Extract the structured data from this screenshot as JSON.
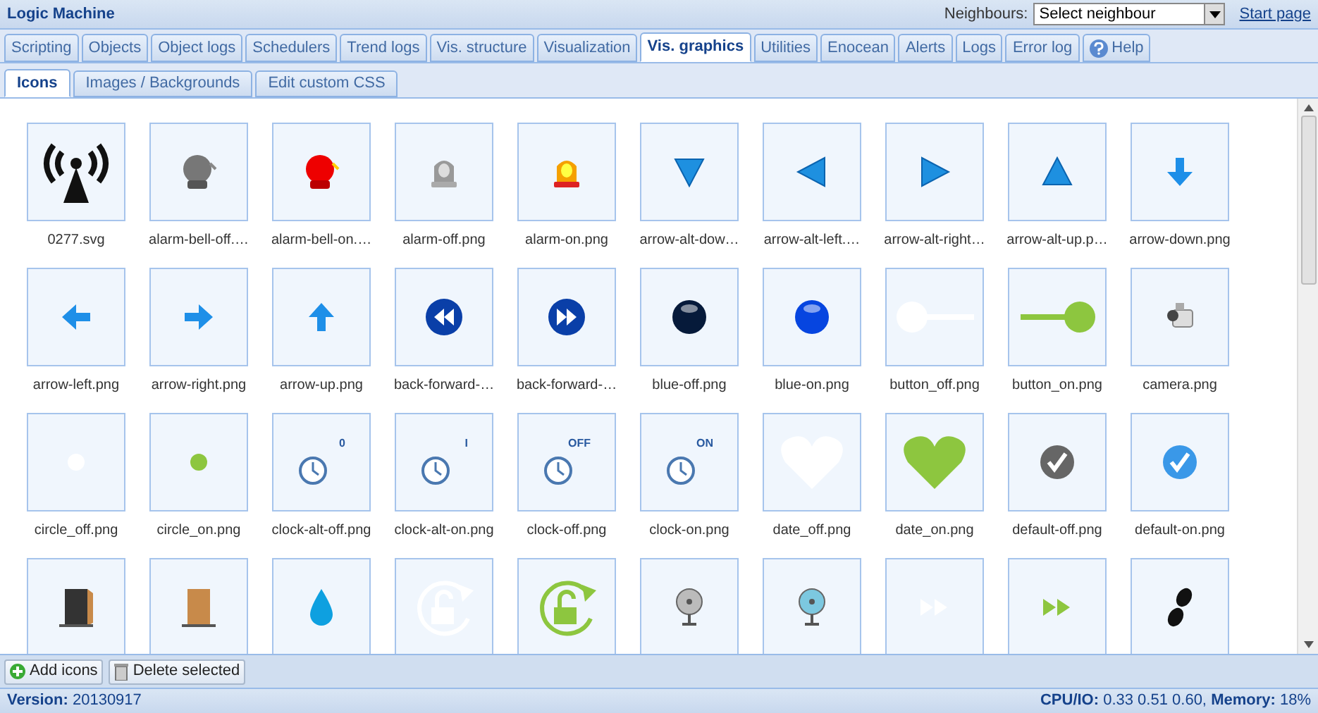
{
  "window": {
    "title": "Logic Machine"
  },
  "neighbours": {
    "label": "Neighbours:",
    "placeholder": "Select neighbour"
  },
  "start_link": "Start page",
  "tabs": [
    {
      "label": "Scripting",
      "selected": false
    },
    {
      "label": "Objects",
      "selected": false
    },
    {
      "label": "Object logs",
      "selected": false
    },
    {
      "label": "Schedulers",
      "selected": false
    },
    {
      "label": "Trend logs",
      "selected": false
    },
    {
      "label": "Vis. structure",
      "selected": false
    },
    {
      "label": "Visualization",
      "selected": false
    },
    {
      "label": "Vis. graphics",
      "selected": true
    },
    {
      "label": "Utilities",
      "selected": false
    },
    {
      "label": "Enocean",
      "selected": false
    },
    {
      "label": "Alerts",
      "selected": false
    },
    {
      "label": "Logs",
      "selected": false
    },
    {
      "label": "Error log",
      "selected": false
    },
    {
      "label": "Help",
      "selected": false,
      "kind": "help"
    }
  ],
  "subtabs": [
    {
      "label": "Icons",
      "selected": true
    },
    {
      "label": "Images / Backgrounds",
      "selected": false
    },
    {
      "label": "Edit custom CSS",
      "selected": false
    }
  ],
  "icons": [
    {
      "label": "0277.svg",
      "kind": "antenna"
    },
    {
      "label": "alarm-bell-off.…",
      "kind": "bell",
      "on": false
    },
    {
      "label": "alarm-bell-on.…",
      "kind": "bell",
      "on": true
    },
    {
      "label": "alarm-off.png",
      "kind": "beacon",
      "on": false
    },
    {
      "label": "alarm-on.png",
      "kind": "beacon",
      "on": true
    },
    {
      "label": "arrow-alt-dow…",
      "kind": "downtriangle"
    },
    {
      "label": "arrow-alt-left.…",
      "kind": "lefttriangle"
    },
    {
      "label": "arrow-alt-right…",
      "kind": "righttriangle"
    },
    {
      "label": "arrow-alt-up.p…",
      "kind": "uptriangle"
    },
    {
      "label": "arrow-down.png",
      "kind": "downarrow"
    },
    {
      "label": "arrow-left.png",
      "kind": "leftarrow"
    },
    {
      "label": "arrow-right.png",
      "kind": "rightarrow"
    },
    {
      "label": "arrow-up.png",
      "kind": "uparrow"
    },
    {
      "label": "back-forward-…",
      "kind": "rewind"
    },
    {
      "label": "back-forward-…",
      "kind": "forward"
    },
    {
      "label": "blue-off.png",
      "kind": "sphere",
      "on": false
    },
    {
      "label": "blue-on.png",
      "kind": "sphere",
      "on": true
    },
    {
      "label": "button_off.png",
      "kind": "toggle",
      "on": false
    },
    {
      "label": "button_on.png",
      "kind": "toggle",
      "on": true
    },
    {
      "label": "camera.png",
      "kind": "camera"
    },
    {
      "label": "circle_off.png",
      "kind": "dot",
      "on": false
    },
    {
      "label": "circle_on.png",
      "kind": "dot",
      "on": true
    },
    {
      "label": "clock-alt-off.png",
      "kind": "clock",
      "badge": "0"
    },
    {
      "label": "clock-alt-on.png",
      "kind": "clock",
      "badge": "I"
    },
    {
      "label": "clock-off.png",
      "kind": "clock",
      "badge": "OFF"
    },
    {
      "label": "clock-on.png",
      "kind": "clock",
      "badge": "ON"
    },
    {
      "label": "date_off.png",
      "kind": "heart",
      "on": false
    },
    {
      "label": "date_on.png",
      "kind": "heart",
      "on": true
    },
    {
      "label": "default-off.png",
      "kind": "check",
      "on": false
    },
    {
      "label": "default-on.png",
      "kind": "check",
      "on": true
    },
    {
      "kind": "door",
      "on": true
    },
    {
      "kind": "door",
      "on": false
    },
    {
      "kind": "drop"
    },
    {
      "kind": "lock",
      "on": false
    },
    {
      "kind": "lock",
      "on": true
    },
    {
      "kind": "fan",
      "on": false
    },
    {
      "kind": "fan",
      "on": true
    },
    {
      "kind": "fastforward",
      "on": false
    },
    {
      "kind": "fastforward",
      "on": true
    },
    {
      "kind": "footprints"
    }
  ],
  "toolbar": [
    {
      "label": "Add icons",
      "kind": "add"
    },
    {
      "label": "Delete selected",
      "kind": "delete"
    }
  ],
  "status": {
    "version_label": "Version:",
    "version": "20130917",
    "cpu_label": "CPU/IO:",
    "cpu": "0.33 0.51 0.60,",
    "memory_label": "Memory:",
    "memory": "18%"
  }
}
